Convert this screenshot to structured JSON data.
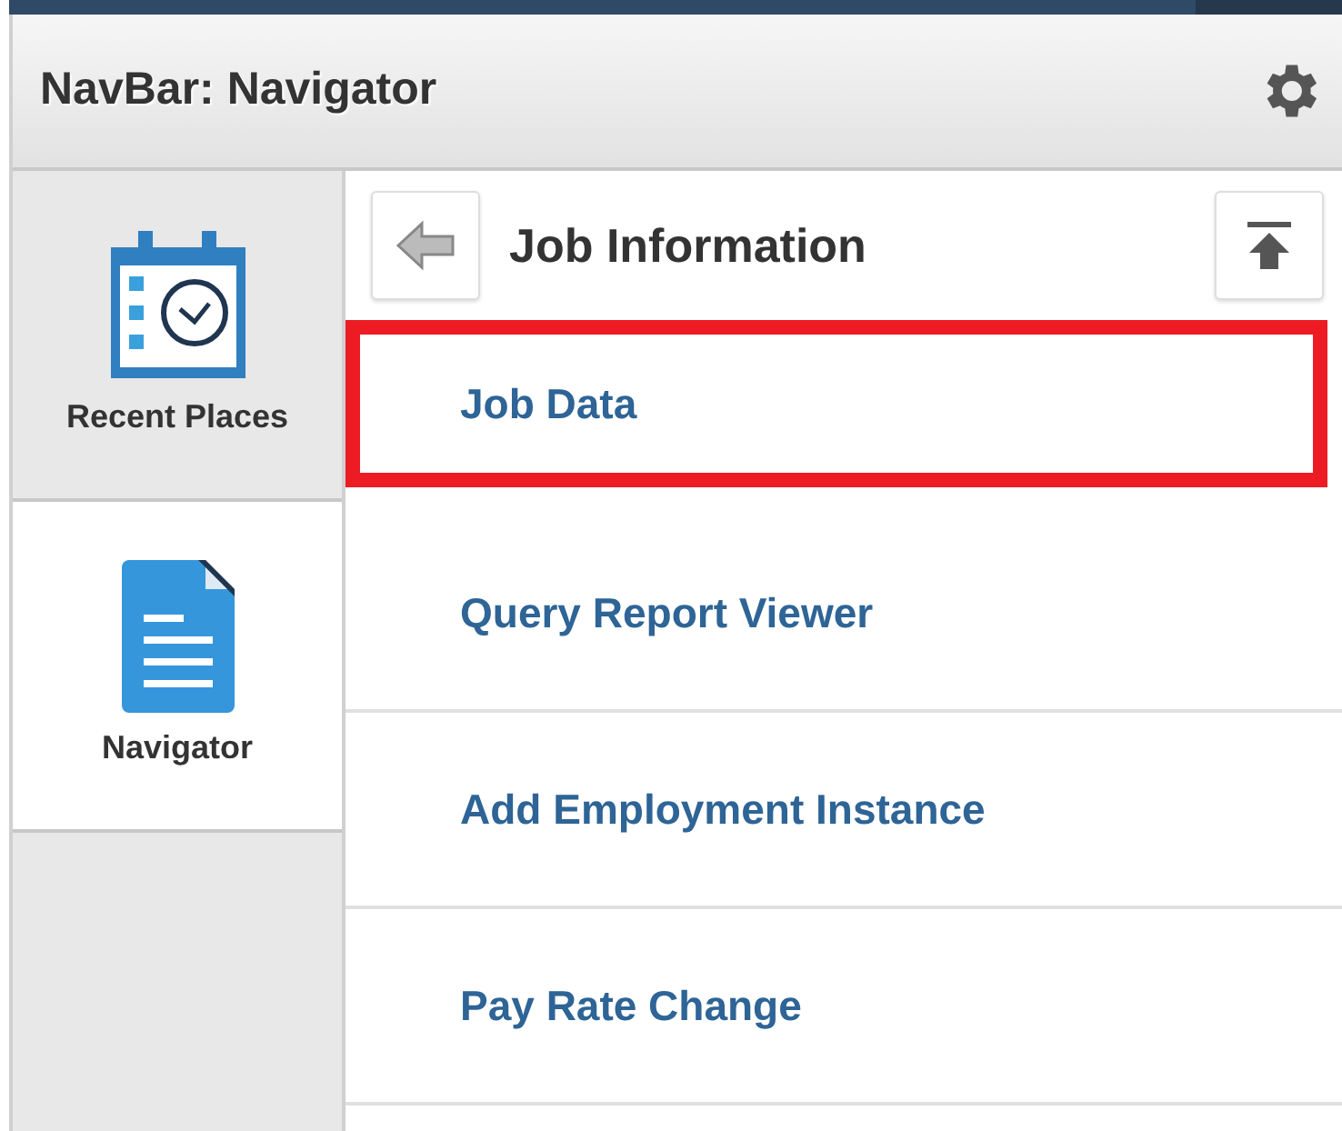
{
  "header": {
    "title": "NavBar: Navigator"
  },
  "tabs": [
    {
      "label": "Recent Places",
      "kind": "recent",
      "selected": false
    },
    {
      "label": "Navigator",
      "kind": "navigator",
      "selected": true
    }
  ],
  "folder": {
    "title": "Job Information"
  },
  "items": [
    {
      "label": "Job Data",
      "highlighted": true
    },
    {
      "label": "Query Report Viewer",
      "highlighted": false
    },
    {
      "label": "Add Employment Instance",
      "highlighted": false
    },
    {
      "label": "Pay Rate Change",
      "highlighted": false
    }
  ]
}
